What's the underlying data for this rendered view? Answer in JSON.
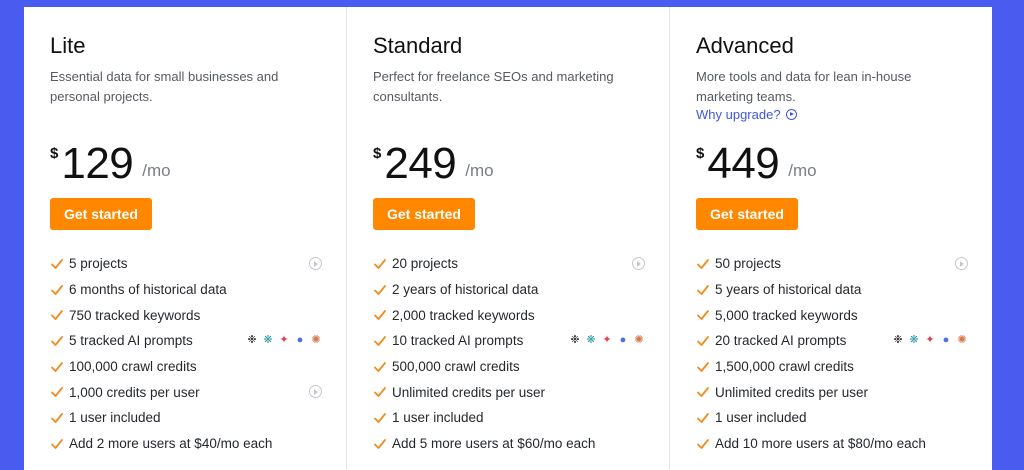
{
  "colors": {
    "accent": "#ff8800",
    "link": "#3f57d9",
    "background": "#4a5cf0",
    "check": "#f08c1e"
  },
  "icons": {
    "check": "check-icon",
    "play": "play-circle-icon",
    "ai_models": [
      "openai-icon",
      "perplexity-icon",
      "gemini-icon",
      "copilot-icon",
      "claude-icon"
    ]
  },
  "plans": [
    {
      "name": "Lite",
      "description": "Essential data for small businesses and personal projects.",
      "currency": "$",
      "price": "129",
      "period": "/mo",
      "cta": "Get started",
      "features": [
        "5 projects",
        "6 months of historical data",
        "750 tracked keywords",
        "5 tracked AI prompts",
        "100,000 crawl credits",
        "1,000 credits per user",
        "1 user included",
        "Add 2 more users at $40/mo each"
      ]
    },
    {
      "name": "Standard",
      "description": "Perfect for freelance SEOs and marketing consultants.",
      "currency": "$",
      "price": "249",
      "period": "/mo",
      "cta": "Get started",
      "features": [
        "20 projects",
        "2 years of historical data",
        "2,000 tracked keywords",
        "10 tracked AI prompts",
        "500,000 crawl credits",
        "Unlimited credits per user",
        "1 user included",
        "Add 5 more users at $60/mo each"
      ]
    },
    {
      "name": "Advanced",
      "description": "More tools and data for lean in-house marketing teams.",
      "why_upgrade": "Why upgrade?",
      "currency": "$",
      "price": "449",
      "period": "/mo",
      "cta": "Get started",
      "features": [
        "50 projects",
        "5 years of historical data",
        "5,000 tracked keywords",
        "20 tracked AI prompts",
        "1,500,000 crawl credits",
        "Unlimited credits per user",
        "1 user included",
        "Add 10 more users at $80/mo each"
      ]
    }
  ]
}
